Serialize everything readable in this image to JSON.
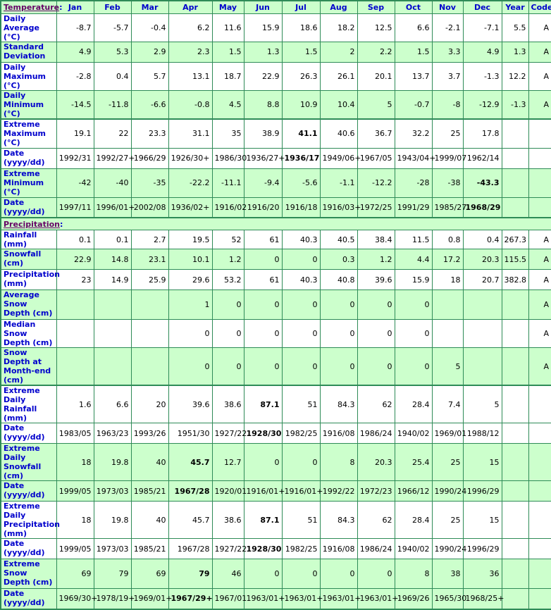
{
  "columns": [
    "Jan",
    "Feb",
    "Mar",
    "Apr",
    "May",
    "Jun",
    "Jul",
    "Aug",
    "Sep",
    "Oct",
    "Nov",
    "Dec",
    "Year",
    "Code"
  ],
  "sections": [
    {
      "title": "Temperature",
      "rows": [
        {
          "label": "Daily Average (°C)",
          "shade": "w",
          "values": [
            "-8.7",
            "-5.7",
            "-0.4",
            "6.2",
            "11.6",
            "15.9",
            "18.6",
            "18.2",
            "12.5",
            "6.6",
            "-2.1",
            "-7.1",
            "5.5",
            "A"
          ],
          "bold": []
        },
        {
          "label": "Standard Deviation",
          "shade": "g",
          "values": [
            "4.9",
            "5.3",
            "2.9",
            "2.3",
            "1.5",
            "1.3",
            "1.5",
            "2",
            "2.2",
            "1.5",
            "3.3",
            "4.9",
            "1.3",
            "A"
          ],
          "bold": []
        },
        {
          "label": "Daily Maximum (°C)",
          "shade": "w",
          "values": [
            "-2.8",
            "0.4",
            "5.7",
            "13.1",
            "18.7",
            "22.9",
            "26.3",
            "26.1",
            "20.1",
            "13.7",
            "3.7",
            "-1.3",
            "12.2",
            "A"
          ],
          "bold": []
        },
        {
          "label": "Daily Minimum (°C)",
          "shade": "g",
          "values": [
            "-14.5",
            "-11.8",
            "-6.6",
            "-0.8",
            "4.5",
            "8.8",
            "10.9",
            "10.4",
            "5",
            "-0.7",
            "-8",
            "-12.9",
            "-1.3",
            "A"
          ],
          "bold": []
        },
        {
          "label": "Extreme Maximum (°C)",
          "shade": "w",
          "group_top": true,
          "values": [
            "19.1",
            "22",
            "23.3",
            "31.1",
            "35",
            "38.9",
            "41.1",
            "40.6",
            "36.7",
            "32.2",
            "25",
            "17.8",
            "",
            ""
          ],
          "bold": [
            6
          ]
        },
        {
          "label": "Date (yyyy/dd)",
          "shade": "w",
          "values": [
            "1992/31",
            "1992/27+",
            "1966/29",
            "1926/30+",
            "1986/30",
            "1936/27+",
            "1936/17",
            "1949/06+",
            "1967/05",
            "1943/04+",
            "1999/07",
            "1962/14",
            "",
            ""
          ],
          "bold": [
            6
          ]
        },
        {
          "label": "Extreme Minimum (°C)",
          "shade": "g",
          "values": [
            "-42",
            "-40",
            "-35",
            "-22.2",
            "-11.1",
            "-9.4",
            "-5.6",
            "-1.1",
            "-12.2",
            "-28",
            "-38",
            "-43.3",
            "",
            ""
          ],
          "bold": [
            11
          ]
        },
        {
          "label": "Date (yyyy/dd)",
          "shade": "g",
          "values": [
            "1997/11",
            "1996/01+",
            "2002/08",
            "1936/02+",
            "1916/02",
            "1916/20",
            "1916/18",
            "1916/03+",
            "1972/25",
            "1991/29",
            "1985/27",
            "1968/29",
            "",
            ""
          ],
          "bold": [
            11
          ]
        }
      ]
    },
    {
      "title": "Precipitation",
      "rows": [
        {
          "label": "Rainfall (mm)",
          "shade": "w",
          "values": [
            "0.1",
            "0.1",
            "2.7",
            "19.5",
            "52",
            "61",
            "40.3",
            "40.5",
            "38.4",
            "11.5",
            "0.8",
            "0.4",
            "267.3",
            "A"
          ],
          "bold": []
        },
        {
          "label": "Snowfall (cm)",
          "shade": "g",
          "values": [
            "22.9",
            "14.8",
            "23.1",
            "10.1",
            "1.2",
            "0",
            "0",
            "0.3",
            "1.2",
            "4.4",
            "17.2",
            "20.3",
            "115.5",
            "A"
          ],
          "bold": []
        },
        {
          "label": "Precipitation (mm)",
          "shade": "w",
          "values": [
            "23",
            "14.9",
            "25.9",
            "29.6",
            "53.2",
            "61",
            "40.3",
            "40.8",
            "39.6",
            "15.9",
            "18",
            "20.7",
            "382.8",
            "A"
          ],
          "bold": []
        },
        {
          "label": "Average Snow Depth (cm)",
          "shade": "g",
          "values": [
            "",
            "",
            "",
            "1",
            "0",
            "0",
            "0",
            "0",
            "0",
            "0",
            "",
            "",
            "",
            "A"
          ],
          "bold": []
        },
        {
          "label": "Median Snow Depth (cm)",
          "shade": "w",
          "values": [
            "",
            "",
            "",
            "0",
            "0",
            "0",
            "0",
            "0",
            "0",
            "0",
            "",
            "",
            "",
            "A"
          ],
          "bold": []
        },
        {
          "label": "Snow Depth at Month-end (cm)",
          "shade": "g",
          "values": [
            "",
            "",
            "",
            "0",
            "0",
            "0",
            "0",
            "0",
            "0",
            "0",
            "5",
            "",
            "",
            "A"
          ],
          "bold": []
        },
        {
          "label": "Extreme Daily Rainfall (mm)",
          "shade": "w",
          "group_top": true,
          "values": [
            "1.6",
            "6.6",
            "20",
            "39.6",
            "38.6",
            "87.1",
            "51",
            "84.3",
            "62",
            "28.4",
            "7.4",
            "5",
            "",
            ""
          ],
          "bold": [
            5
          ]
        },
        {
          "label": "Date (yyyy/dd)",
          "shade": "w",
          "values": [
            "1983/05",
            "1963/23",
            "1993/26",
            "1951/30",
            "1927/22",
            "1928/30",
            "1982/25",
            "1916/08",
            "1986/24",
            "1940/02",
            "1969/01",
            "1988/12",
            "",
            ""
          ],
          "bold": [
            5
          ]
        },
        {
          "label": "Extreme Daily Snowfall (cm)",
          "shade": "g",
          "values": [
            "18",
            "19.8",
            "40",
            "45.7",
            "12.7",
            "0",
            "0",
            "8",
            "20.3",
            "25.4",
            "25",
            "15",
            "",
            ""
          ],
          "bold": [
            3
          ]
        },
        {
          "label": "Date (yyyy/dd)",
          "shade": "g",
          "values": [
            "1999/05",
            "1973/03",
            "1985/21",
            "1967/28",
            "1920/01",
            "1916/01+",
            "1916/01+",
            "1992/22",
            "1972/23",
            "1966/12",
            "1990/24",
            "1996/29",
            "",
            ""
          ],
          "bold": [
            3
          ]
        },
        {
          "label": "Extreme Daily Precipitation (mm)",
          "shade": "w",
          "values": [
            "18",
            "19.8",
            "40",
            "45.7",
            "38.6",
            "87.1",
            "51",
            "84.3",
            "62",
            "28.4",
            "25",
            "15",
            "",
            ""
          ],
          "bold": [
            5
          ]
        },
        {
          "label": "Date (yyyy/dd)",
          "shade": "w",
          "values": [
            "1999/05",
            "1973/03",
            "1985/21",
            "1967/28",
            "1927/22",
            "1928/30",
            "1982/25",
            "1916/08",
            "1986/24",
            "1940/02",
            "1990/24",
            "1996/29",
            "",
            ""
          ],
          "bold": [
            5
          ]
        },
        {
          "label": "Extreme Snow Depth (cm)",
          "shade": "g",
          "values": [
            "69",
            "79",
            "69",
            "79",
            "46",
            "0",
            "0",
            "0",
            "0",
            "8",
            "38",
            "36",
            "",
            ""
          ],
          "bold": [
            3
          ]
        },
        {
          "label": "Date (yyyy/dd)",
          "shade": "g",
          "values": [
            "1969/30+",
            "1978/19+",
            "1969/01+",
            "1967/29+",
            "1967/01",
            "1963/01+",
            "1963/01+",
            "1963/01+",
            "1963/01+",
            "1969/26",
            "1965/30",
            "1968/25+",
            "",
            ""
          ],
          "bold": [
            3
          ]
        }
      ]
    }
  ]
}
